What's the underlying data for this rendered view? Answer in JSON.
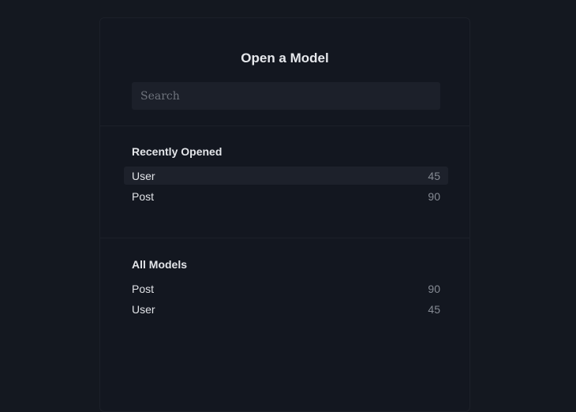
{
  "dialog": {
    "title": "Open a Model"
  },
  "search": {
    "placeholder": "Search",
    "value": ""
  },
  "recently_opened": {
    "heading": "Recently Opened",
    "items": [
      {
        "name": "User",
        "count": "45",
        "highlighted": true
      },
      {
        "name": "Post",
        "count": "90",
        "highlighted": false
      }
    ]
  },
  "all_models": {
    "heading": "All Models",
    "items": [
      {
        "name": "Post",
        "count": "90"
      },
      {
        "name": "User",
        "count": "45"
      }
    ]
  },
  "colors": {
    "background": "#141820",
    "panel": "#131720",
    "input_background": "#1c202a",
    "highlight_row": "#1d212b",
    "text_primary": "#e3e5e9",
    "text_muted": "#858a93"
  }
}
